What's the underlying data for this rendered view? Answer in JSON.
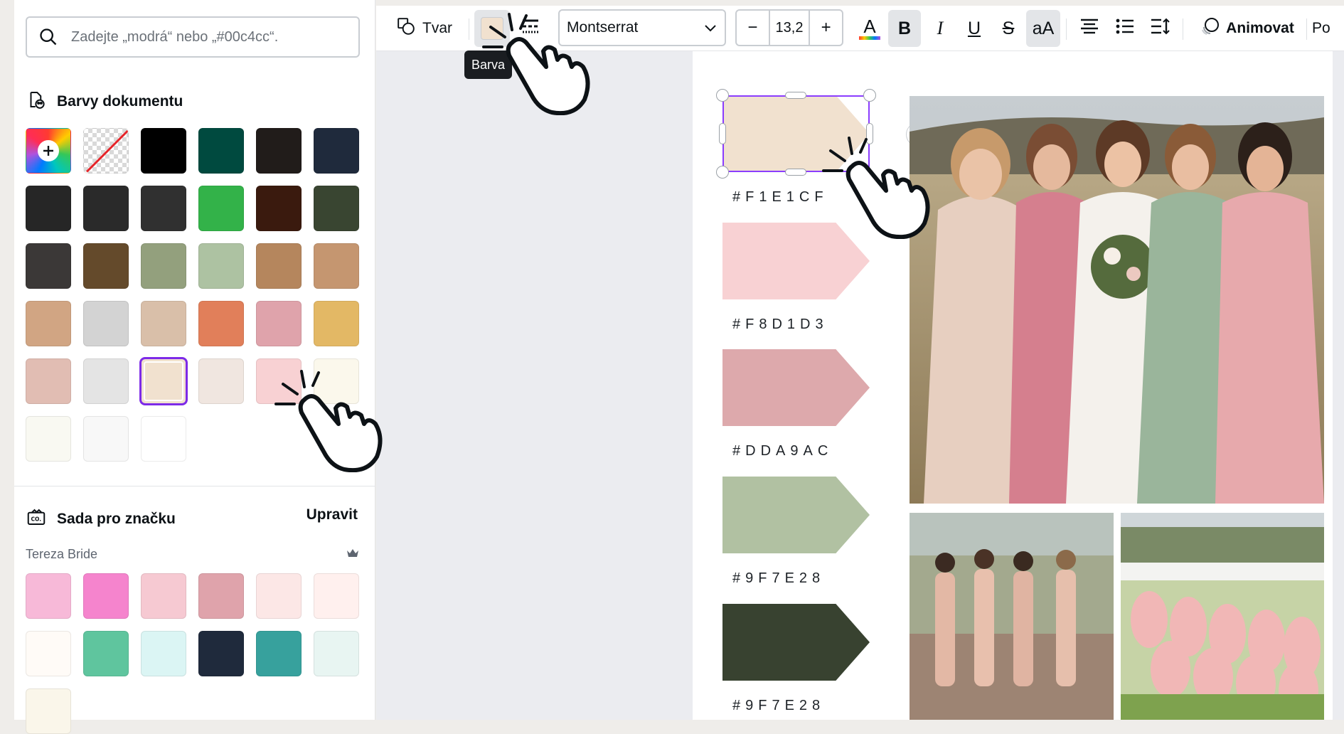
{
  "search": {
    "placeholder": "Zadejte „modrá“ nebo „#00c4cc“."
  },
  "document_colors": {
    "title": "Barvy dokumentu",
    "swatches": [
      "#000000",
      "#004a3f",
      "#211c1a",
      "#1f2a3c",
      "#262626",
      "#2a2a2a",
      "#303030",
      "#33b249",
      "#3a1a0e",
      "#394531",
      "#3b3837",
      "#644a2b",
      "#93a07d",
      "#adc2a2",
      "#b5865d",
      "#c59670",
      "#d1a583",
      "#d3d3d3",
      "#d9bfa9",
      "#e17f5a",
      "#dfa3ab",
      "#e3b865",
      "#e1bdb3",
      "#e4e4e4",
      "#f1e1cf",
      "#f0e6e0",
      "#f8d1d3",
      "#fbf8ec",
      "#f9f9f2",
      "#f8f8f8",
      "#ffffff"
    ],
    "selected": "#f1e1cf"
  },
  "brand_kit": {
    "title": "Sada pro značku",
    "edit_label": "Upravit",
    "name": "Tereza Bride",
    "swatches": [
      "#f7b9d8",
      "#f584cd",
      "#f6c9d2",
      "#dfa3ab",
      "#fce7e6",
      "#fff0ee",
      "#fffbf7",
      "#5fc59e",
      "#dbf5f4",
      "#1f2a3c",
      "#37a19d",
      "#e8f5f2",
      "#faf6ea"
    ]
  },
  "toolbar": {
    "shape_label": "Tvar",
    "font": "Montserrat",
    "font_size": "13,2",
    "minus": "−",
    "plus": "+",
    "text_color_glyph": "A",
    "bold_glyph": "B",
    "italic_glyph": "I",
    "underline_glyph": "U",
    "strike_glyph": "S",
    "case_glyph": "aA",
    "animate_label": "Animovat",
    "position_label": "Po",
    "tooltip": "Barva"
  },
  "palette": [
    {
      "hex": "#F1E1CF",
      "label": "#F1E1CF"
    },
    {
      "hex": "#F8D1D3",
      "label": "#F8D1D3"
    },
    {
      "hex": "#DDA9AC",
      "label": "#DDA9AC"
    },
    {
      "hex": "#B1C1A2",
      "label": "#9F7E28"
    },
    {
      "hex": "#384230",
      "label": "#9F7E28"
    }
  ]
}
